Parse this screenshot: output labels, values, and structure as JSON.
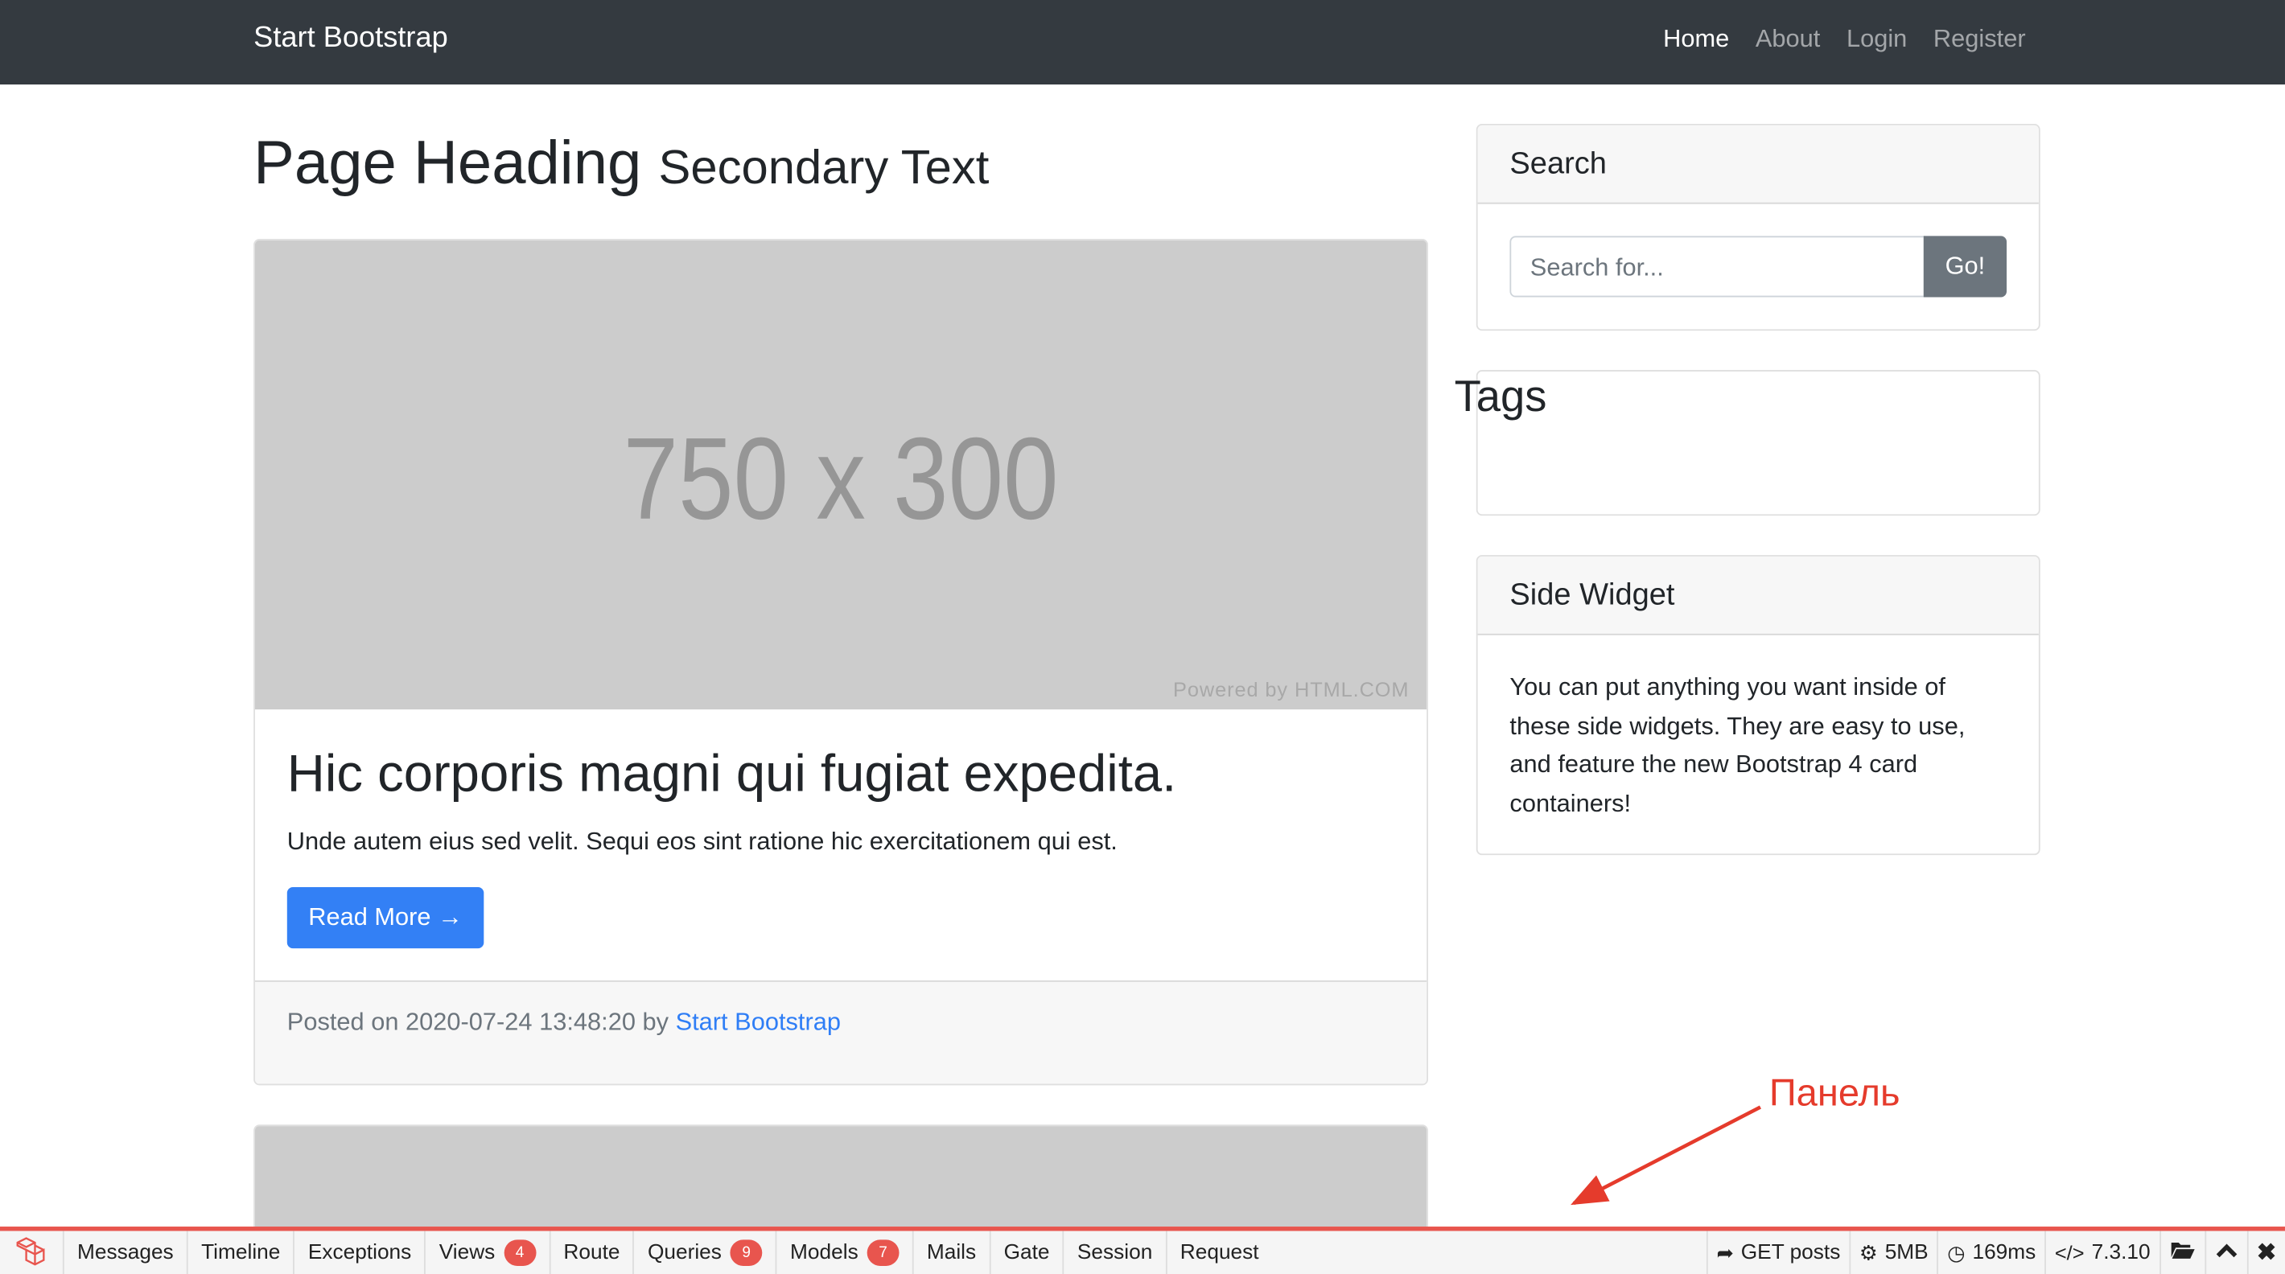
{
  "navbar": {
    "brand": "Start Bootstrap",
    "links": [
      "Home",
      "About",
      "Login",
      "Register"
    ]
  },
  "heading": {
    "title": "Page Heading",
    "subtitle": "Secondary Text"
  },
  "posts": [
    {
      "image_text": "750 x 300",
      "image_credit": "Powered by HTML.COM",
      "title": "Hic corporis magni qui fugiat expedita.",
      "excerpt": "Unde autem eius sed velit. Sequi eos sint ratione hic exercitationem qui est.",
      "read_more": "Read More →",
      "posted_prefix": "Posted on 2020-07-24 13:48:20 by ",
      "author": "Start Bootstrap"
    }
  ],
  "sidebar": {
    "search": {
      "title": "Search",
      "placeholder": "Search for...",
      "button": "Go!"
    },
    "tags": {
      "title": "Tags"
    },
    "widget": {
      "title": "Side Widget",
      "body": "You can put anything you want inside of these side widgets. They are easy to use, and feature the new Bootstrap 4 card containers!"
    }
  },
  "annotation": {
    "label": "Панель",
    "color": "#e53b2c"
  },
  "debugbar": {
    "accent_color": "#e8554e",
    "tabs": [
      {
        "label": "Messages",
        "badge": ""
      },
      {
        "label": "Timeline",
        "badge": ""
      },
      {
        "label": "Exceptions",
        "badge": ""
      },
      {
        "label": "Views",
        "badge": "4"
      },
      {
        "label": "Route",
        "badge": ""
      },
      {
        "label": "Queries",
        "badge": "9"
      },
      {
        "label": "Models",
        "badge": "7"
      },
      {
        "label": "Mails",
        "badge": ""
      },
      {
        "label": "Gate",
        "badge": ""
      },
      {
        "label": "Session",
        "badge": ""
      },
      {
        "label": "Request",
        "badge": ""
      }
    ],
    "request": "GET posts",
    "memory": "5MB",
    "time": "169ms",
    "php_version": "7.3.10",
    "icons": [
      "laravel-logo-icon",
      "share-icon",
      "cogs-icon",
      "clock-icon",
      "code-icon",
      "folder-open-icon",
      "chevron-up-icon",
      "close-icon"
    ]
  }
}
